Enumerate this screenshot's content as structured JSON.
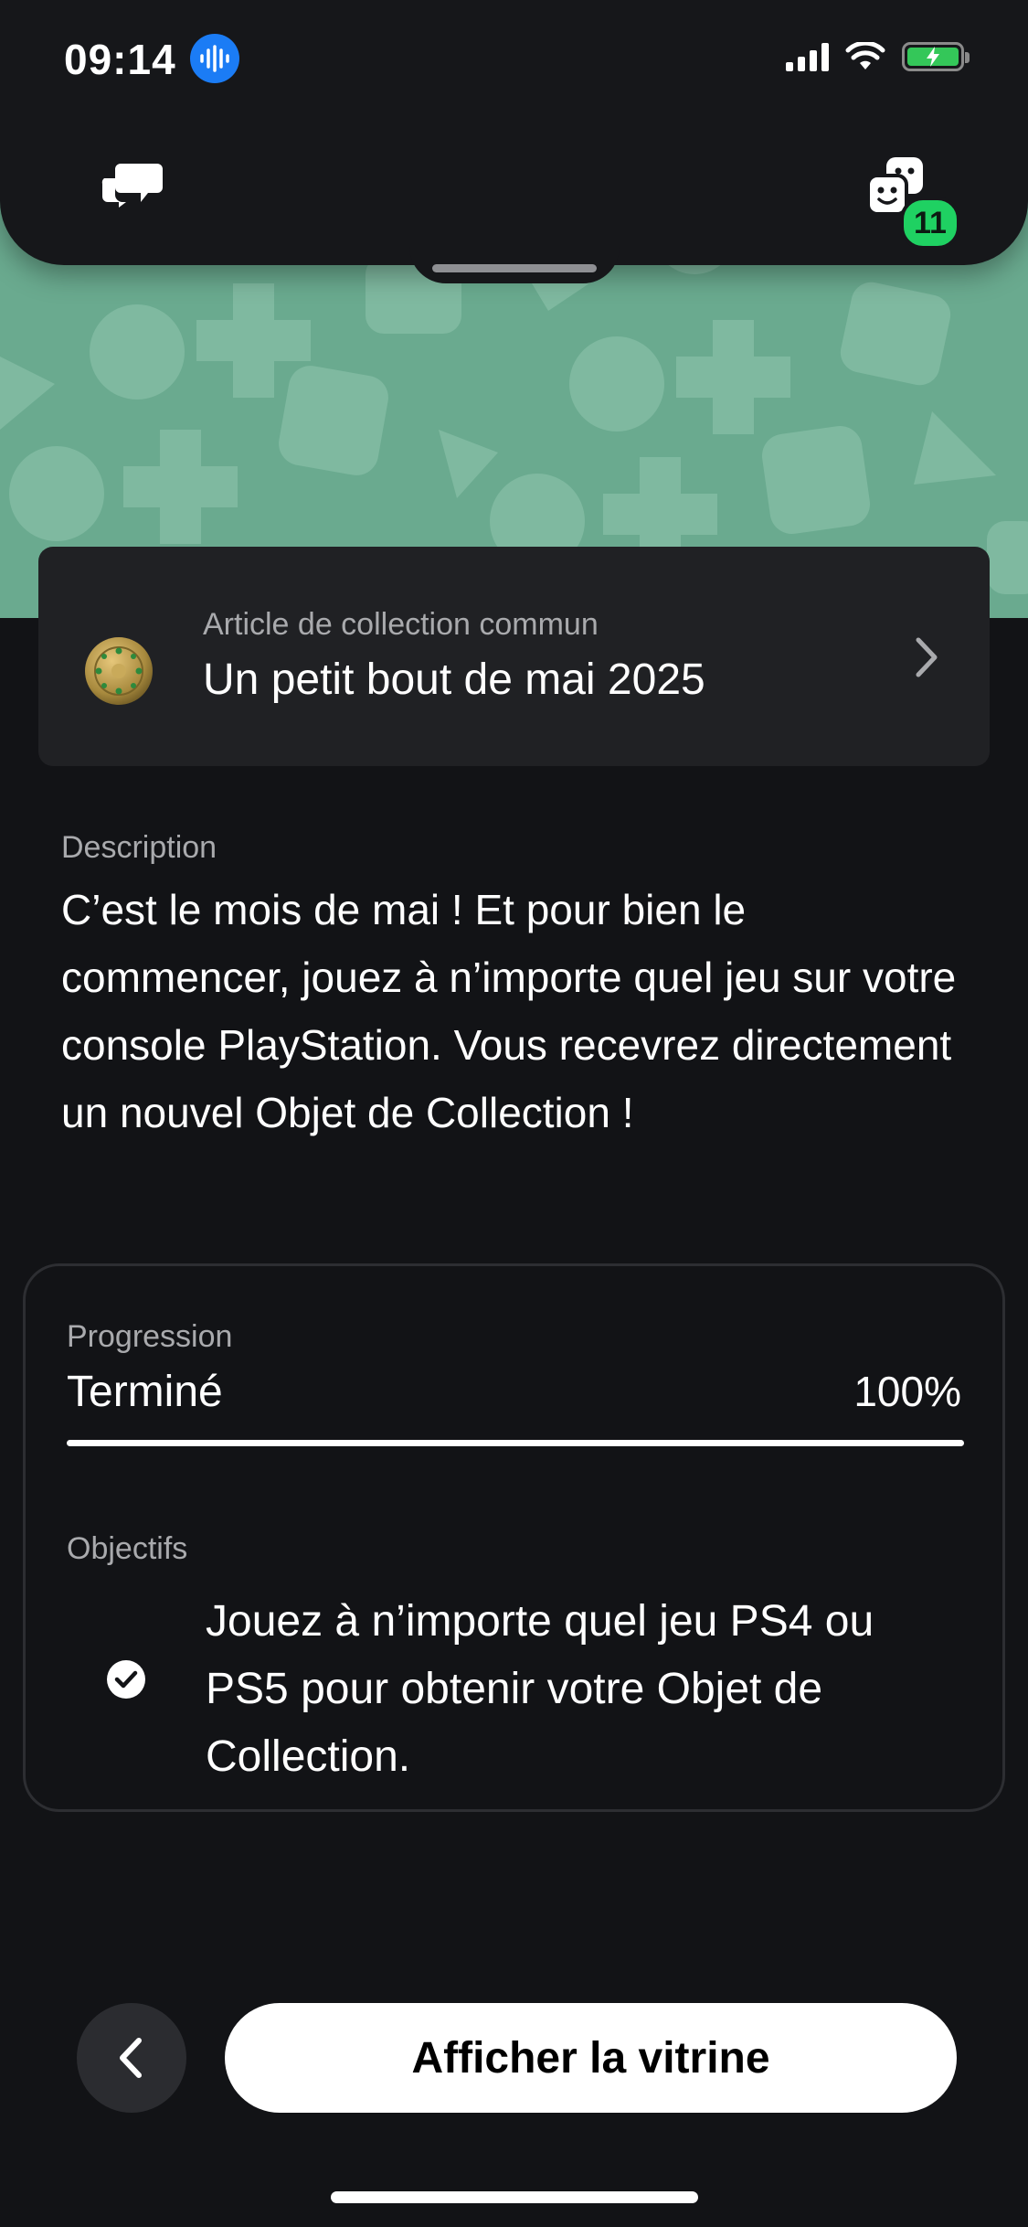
{
  "status_bar": {
    "time": "09:14"
  },
  "top_bar": {
    "friends_badge_count": "11"
  },
  "collectible": {
    "rarity_label": "Article de collection commun",
    "title": "Un petit bout de mai 2025"
  },
  "description": {
    "label": "Description",
    "text": "C’est le mois de mai ! Et pour bien le commencer, jouez à n’importe quel jeu sur votre console PlayStation. Vous recevrez directement un nouvel Objet de Collection !"
  },
  "progress": {
    "label": "Progression",
    "status": "Terminé",
    "percent_text": "100%",
    "fraction": 1.0
  },
  "objectives": {
    "label": "Objectifs",
    "items": [
      {
        "text": "Jouez à n’importe quel jeu PS4 ou PS5 pour obtenir votre Objet de Collection.",
        "completed": true
      }
    ]
  },
  "actions": {
    "showcase_label": "Afficher la vitrine"
  },
  "colors": {
    "hero_green": "#6aaa8f",
    "badge_green": "#1fd162",
    "background": "#121316",
    "card": "#202124"
  }
}
